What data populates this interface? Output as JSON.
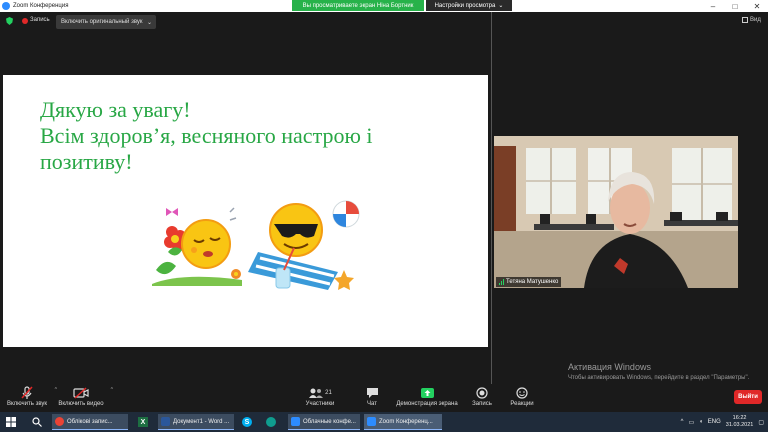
{
  "window": {
    "title": "Zoom Конференция",
    "share_banner": "Вы просматриваете экран Ніна Бортник",
    "view_options": "Настройки просмотра",
    "controls": [
      "–",
      "□",
      "✕"
    ]
  },
  "meeting": {
    "record_label": "Запись",
    "original_sound": "Включить оригинальный звук",
    "view_label": "Вид"
  },
  "slide": {
    "lines": [
      "Дякую за увагу!",
      "Всім здоров’я, весняного настрою і",
      "позитиву!"
    ]
  },
  "video": {
    "participant": "Тетяна Матушенко"
  },
  "activation": {
    "title": "Активация Windows",
    "text": "Чтобы активировать Windows, перейдите в раздел \"Параметры\"."
  },
  "toolbar": {
    "mute": "Включить звук",
    "video": "Включить видео",
    "participants": "Участники",
    "participants_count": "21",
    "chat": "Чат",
    "share": "Демонстрация экрана",
    "record": "Запись",
    "reactions": "Реакции",
    "exit": "Выйти"
  },
  "taskbar": {
    "apps": [
      {
        "label": "Облікові запис...",
        "color": "#ea4335"
      },
      {
        "label": "Документ1 - Word ...",
        "color": "#2b579a"
      },
      {
        "label": "Облачные конфе...",
        "color": "#2d8cff"
      },
      {
        "label": "Zoom Конференц...",
        "color": "#2d8cff"
      }
    ],
    "lang": "ENG",
    "time": "16:22",
    "date": "31.03.2021"
  },
  "colors": {
    "slide_text": "#28a745",
    "share_banner": "#27b24a",
    "exit": "#e02828",
    "share_icon": "#23d160"
  }
}
